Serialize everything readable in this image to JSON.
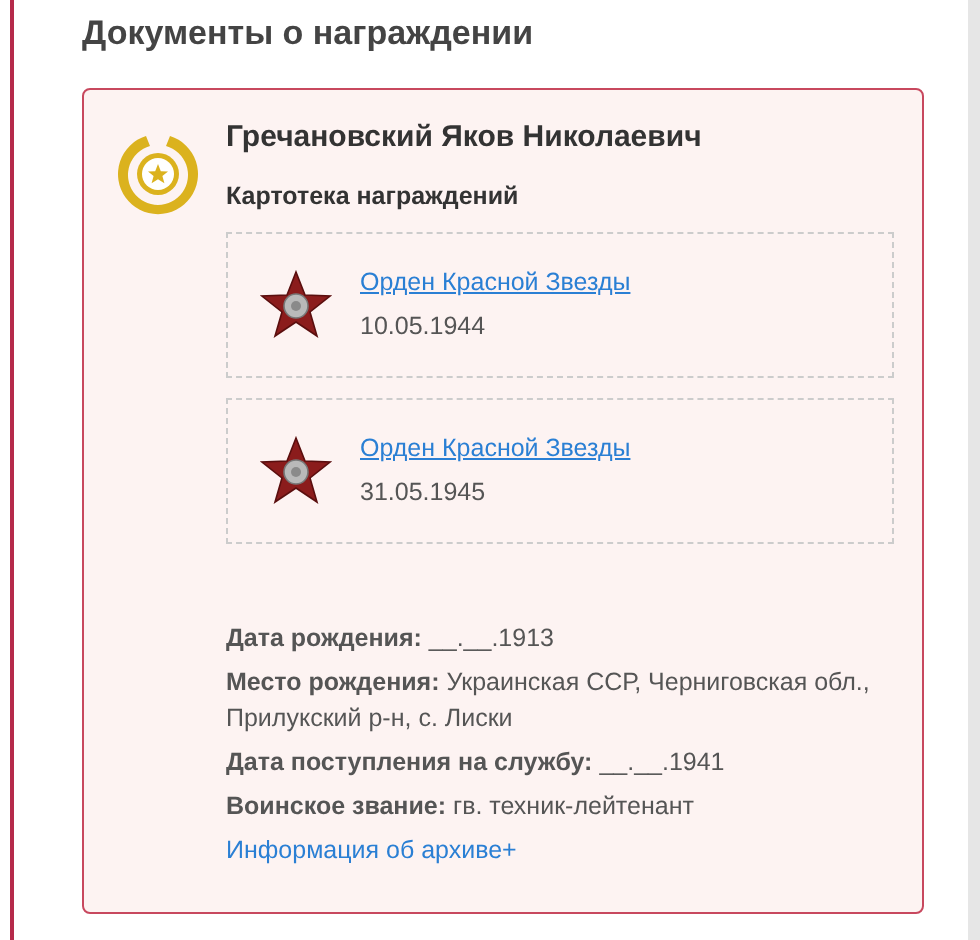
{
  "section_title": "Документы о награждении",
  "person": {
    "name": "Гречановский Яков Николаевич",
    "subtitle": "Картотека награждений"
  },
  "awards": [
    {
      "name": "Орден Красной Звезды",
      "date": "10.05.1944"
    },
    {
      "name": "Орден Красной Звезды",
      "date": "31.05.1945"
    }
  ],
  "facts": [
    "**Дата рождения:** __.__.1913",
    "**Место рождения:** Украинская ССР, Черниговская обл., Прилукский р-н, с. Лиски",
    "**Дата поступления на службу:** __.__.1941",
    "**Воинское звание:** гв. техник-лейтенант"
  ],
  "archive_link": "Информация об архиве+"
}
